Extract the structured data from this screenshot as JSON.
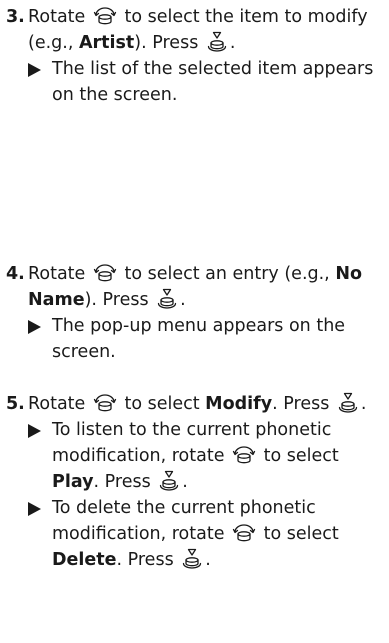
{
  "steps": [
    {
      "number": "3.",
      "head": {
        "t1": "Rotate",
        "rotate_icon": "rotate-dial-icon",
        "t2": "to select the item to modify (e.g.,",
        "bold1": "Artist",
        "t3": "). Press",
        "press_icon": "press-dial-icon",
        "t4": "."
      },
      "bullets": [
        {
          "text": "The list of the selected item appears on the screen."
        }
      ]
    },
    {
      "number": "4.",
      "head": {
        "t1": "Rotate",
        "rotate_icon": "rotate-dial-icon",
        "t2": "to select an entry (e.g.,",
        "bold1": "No Name",
        "t3": "). Press",
        "press_icon": "press-dial-icon",
        "t4": "."
      },
      "bullets": [
        {
          "text": "The pop-up menu appears on the screen."
        }
      ]
    },
    {
      "number": "5.",
      "head": {
        "t1": "Rotate",
        "rotate_icon": "rotate-dial-icon",
        "t2": "to select",
        "bold1": "Modify",
        "t3": ". Press",
        "press_icon": "press-dial-icon",
        "t4": "."
      },
      "bullets": [
        {
          "t1": "To listen to the current phonetic modification, rotate",
          "t2": "to select",
          "bold1": "Play",
          "t3": ". Press",
          "t4": "."
        },
        {
          "t1": "To delete the current phonetic modification, rotate",
          "t2": "to select",
          "bold1": "Delete",
          "t3": ". Press",
          "t4": "."
        }
      ]
    }
  ]
}
